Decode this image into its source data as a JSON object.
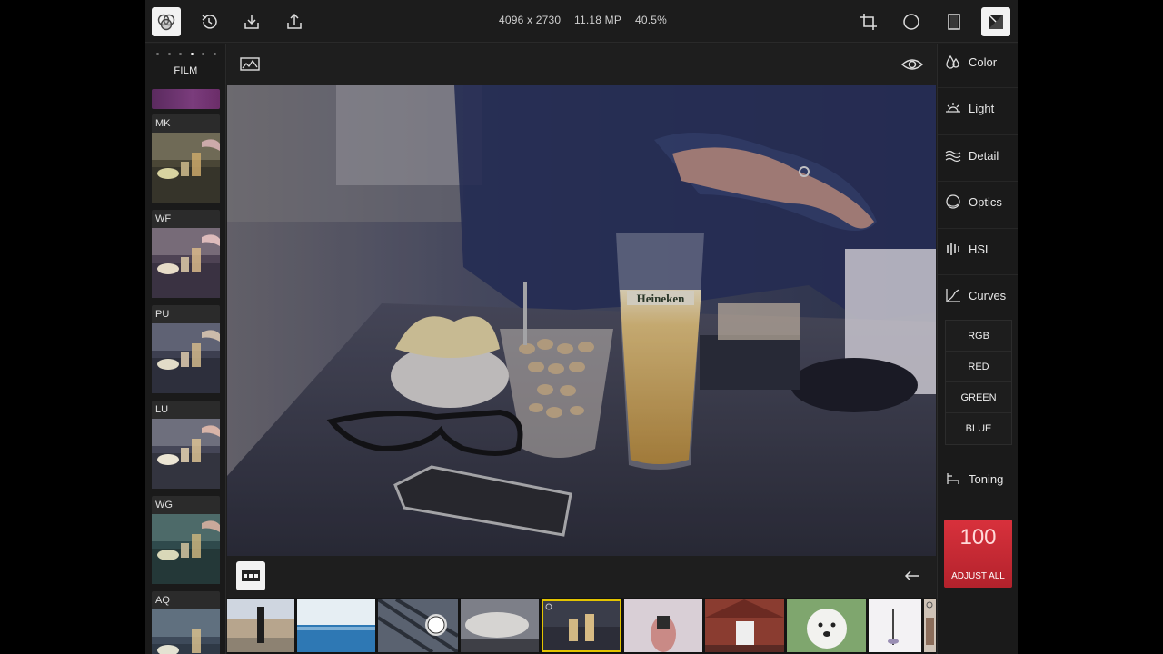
{
  "topbar": {
    "dimensions": "4096 x 2730",
    "megapixels": "11.18 MP",
    "zoom": "40.5%",
    "left_icons": [
      "filters-icon",
      "history-icon",
      "download-icon",
      "share-icon"
    ],
    "right_icons": [
      "crop-icon",
      "vignette-circle-icon",
      "frame-icon",
      "compare-icon"
    ]
  },
  "left_panel": {
    "category": "FILM",
    "filters": [
      {
        "label": "MK"
      },
      {
        "label": "WF"
      },
      {
        "label": "PU"
      },
      {
        "label": "LU"
      },
      {
        "label": "WG"
      },
      {
        "label": "AQ"
      }
    ]
  },
  "canvas": {
    "histogram_icon": "histogram-icon",
    "preview_icon": "eye-icon",
    "filmstrip_toggle_icon": "filmstrip-icon",
    "back_icon": "back-arrow-icon"
  },
  "right_panel": {
    "tools": [
      {
        "label": "Color",
        "icon": "droplets-icon"
      },
      {
        "label": "Light",
        "icon": "sunrise-icon"
      },
      {
        "label": "Detail",
        "icon": "waves-icon"
      },
      {
        "label": "Optics",
        "icon": "lens-icon"
      },
      {
        "label": "HSL",
        "icon": "bars-icon"
      },
      {
        "label": "Curves",
        "icon": "curve-icon"
      }
    ],
    "curves_channels": [
      "RGB",
      "RED",
      "GREEN",
      "BLUE"
    ],
    "toning": {
      "label": "Toning",
      "icon": "toning-icon"
    },
    "adjust_all": {
      "value": "100",
      "label": "ADJUST ALL"
    }
  },
  "photo": {
    "glass_text": "Heineken"
  },
  "colors": {
    "accent_red": "#c8272f",
    "selection_yellow": "#e3c400",
    "panel": "#1a1a1a"
  }
}
